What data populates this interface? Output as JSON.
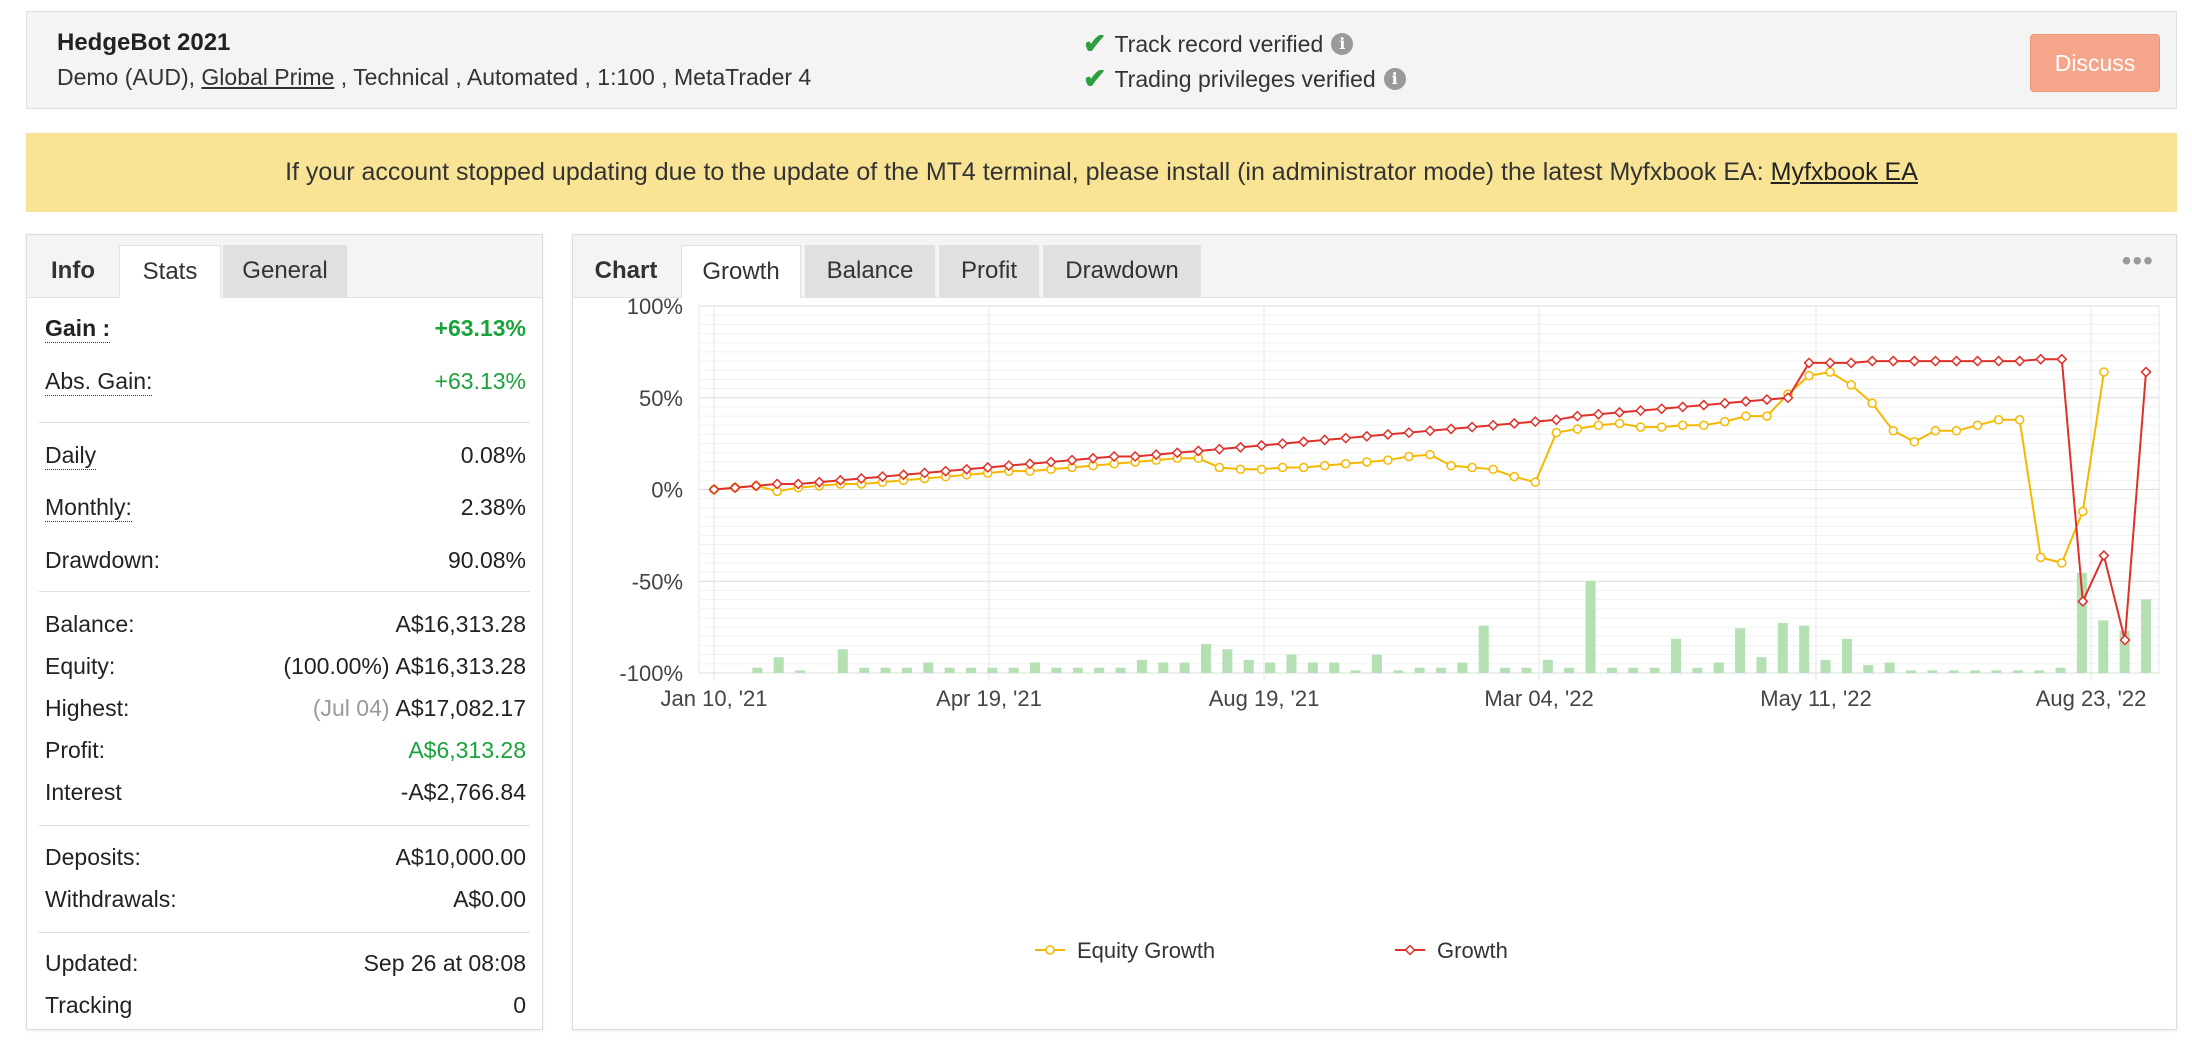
{
  "header": {
    "account_name": "HedgeBot 2021",
    "meta_prefix": "Demo (AUD), ",
    "broker": "Global Prime",
    "meta_suffix": " , Technical , Automated , 1:100 , MetaTrader 4",
    "verify_track": "Track record verified",
    "verify_trading": "Trading privileges verified",
    "discuss_label": "Discuss"
  },
  "notice": {
    "text": "If your account stopped updating due to the update of the MT4 terminal, please install (in administrator mode) the latest Myfxbook EA: ",
    "link": "Myfxbook EA"
  },
  "left_tabs": [
    "Info",
    "Stats",
    "General"
  ],
  "stats": {
    "gain": {
      "label": "Gain :",
      "value": "+63.13%"
    },
    "abs_gain": {
      "label": "Abs. Gain:",
      "value": "+63.13%"
    },
    "daily": {
      "label": "Daily",
      "value": "0.08%"
    },
    "monthly": {
      "label": "Monthly:",
      "value": "2.38%"
    },
    "drawdown": {
      "label": "Drawdown:",
      "value": "90.08%"
    },
    "balance": {
      "label": "Balance:",
      "value": "A$16,313.28"
    },
    "equity": {
      "label": "Equity:",
      "prefix": "(100.00%)",
      "value": "A$16,313.28"
    },
    "highest": {
      "label": "Highest:",
      "prefix": "(Jul 04)",
      "value": "A$17,082.17"
    },
    "profit": {
      "label": "Profit:",
      "value": "A$6,313.28"
    },
    "interest": {
      "label": "Interest",
      "value": "-A$2,766.84"
    },
    "deposits": {
      "label": "Deposits:",
      "value": "A$10,000.00"
    },
    "withdrawals": {
      "label": "Withdrawals:",
      "value": "A$0.00"
    },
    "updated": {
      "label": "Updated:",
      "value": "Sep 26 at 08:08"
    },
    "tracking": {
      "label": "Tracking",
      "value": "0"
    }
  },
  "chart_tabs": [
    "Chart",
    "Growth",
    "Balance",
    "Profit",
    "Drawdown"
  ],
  "colors": {
    "equity_line": "#f5b800",
    "growth_line": "#e0302a",
    "volume_bar": "#b4e0b4",
    "positive": "#1aa33a",
    "discuss": "#f5a58a",
    "notice_bg": "#f8e494"
  },
  "chart_data": {
    "type": "line",
    "ylim": [
      -100,
      100
    ],
    "y_ticks": [
      "100%",
      "50%",
      "0%",
      "-50%",
      "-100%"
    ],
    "x_tick_labels": [
      "Jan 10, '21",
      "Apr 19, '21",
      "Aug 19, '21",
      "Mar 04, '22",
      "May 11, '22",
      "Aug 23, '22"
    ],
    "legend_position": "bottom-center",
    "grid": true,
    "series": [
      {
        "name": "Equity Growth",
        "values": [
          0,
          1,
          2,
          -1,
          1,
          2,
          3,
          3,
          4,
          5,
          6,
          7,
          8,
          9,
          10,
          10,
          11,
          12,
          13,
          14,
          15,
          16,
          17,
          17,
          12,
          11,
          11,
          12,
          12,
          13,
          14,
          15,
          16,
          18,
          19,
          13,
          12,
          11,
          7,
          4,
          31,
          33,
          35,
          36,
          34,
          34,
          35,
          35,
          37,
          40,
          40,
          52,
          62,
          64,
          57,
          47,
          32,
          26,
          32,
          32,
          35,
          38,
          38,
          -37,
          -40,
          -12,
          64
        ]
      },
      {
        "name": "Growth",
        "values": [
          0,
          1,
          2,
          3,
          3,
          4,
          5,
          6,
          7,
          8,
          9,
          10,
          11,
          12,
          13,
          14,
          15,
          16,
          17,
          18,
          18,
          19,
          20,
          21,
          22,
          23,
          24,
          25,
          26,
          27,
          28,
          29,
          30,
          31,
          32,
          33,
          34,
          35,
          36,
          37,
          38,
          40,
          41,
          42,
          43,
          44,
          45,
          46,
          47,
          48,
          49,
          50,
          69,
          69,
          69,
          70,
          70,
          70,
          70,
          70,
          70,
          70,
          70,
          71,
          71,
          -61,
          -36,
          -82,
          64
        ]
      },
      {
        "name": "volume",
        "values": [
          0,
          2,
          6,
          1,
          0,
          9,
          2,
          2,
          2,
          4,
          2,
          2,
          2,
          2,
          4,
          2,
          2,
          2,
          2,
          5,
          4,
          4,
          11,
          9,
          5,
          4,
          7,
          4,
          4,
          1,
          7,
          1,
          2,
          2,
          4,
          18,
          2,
          2,
          5,
          2,
          35,
          2,
          2,
          2,
          13,
          2,
          4,
          17,
          6,
          19,
          18,
          5,
          13,
          3,
          4,
          1,
          1,
          1,
          1,
          1,
          1,
          1,
          2,
          38,
          20,
          16,
          28
        ]
      }
    ]
  }
}
